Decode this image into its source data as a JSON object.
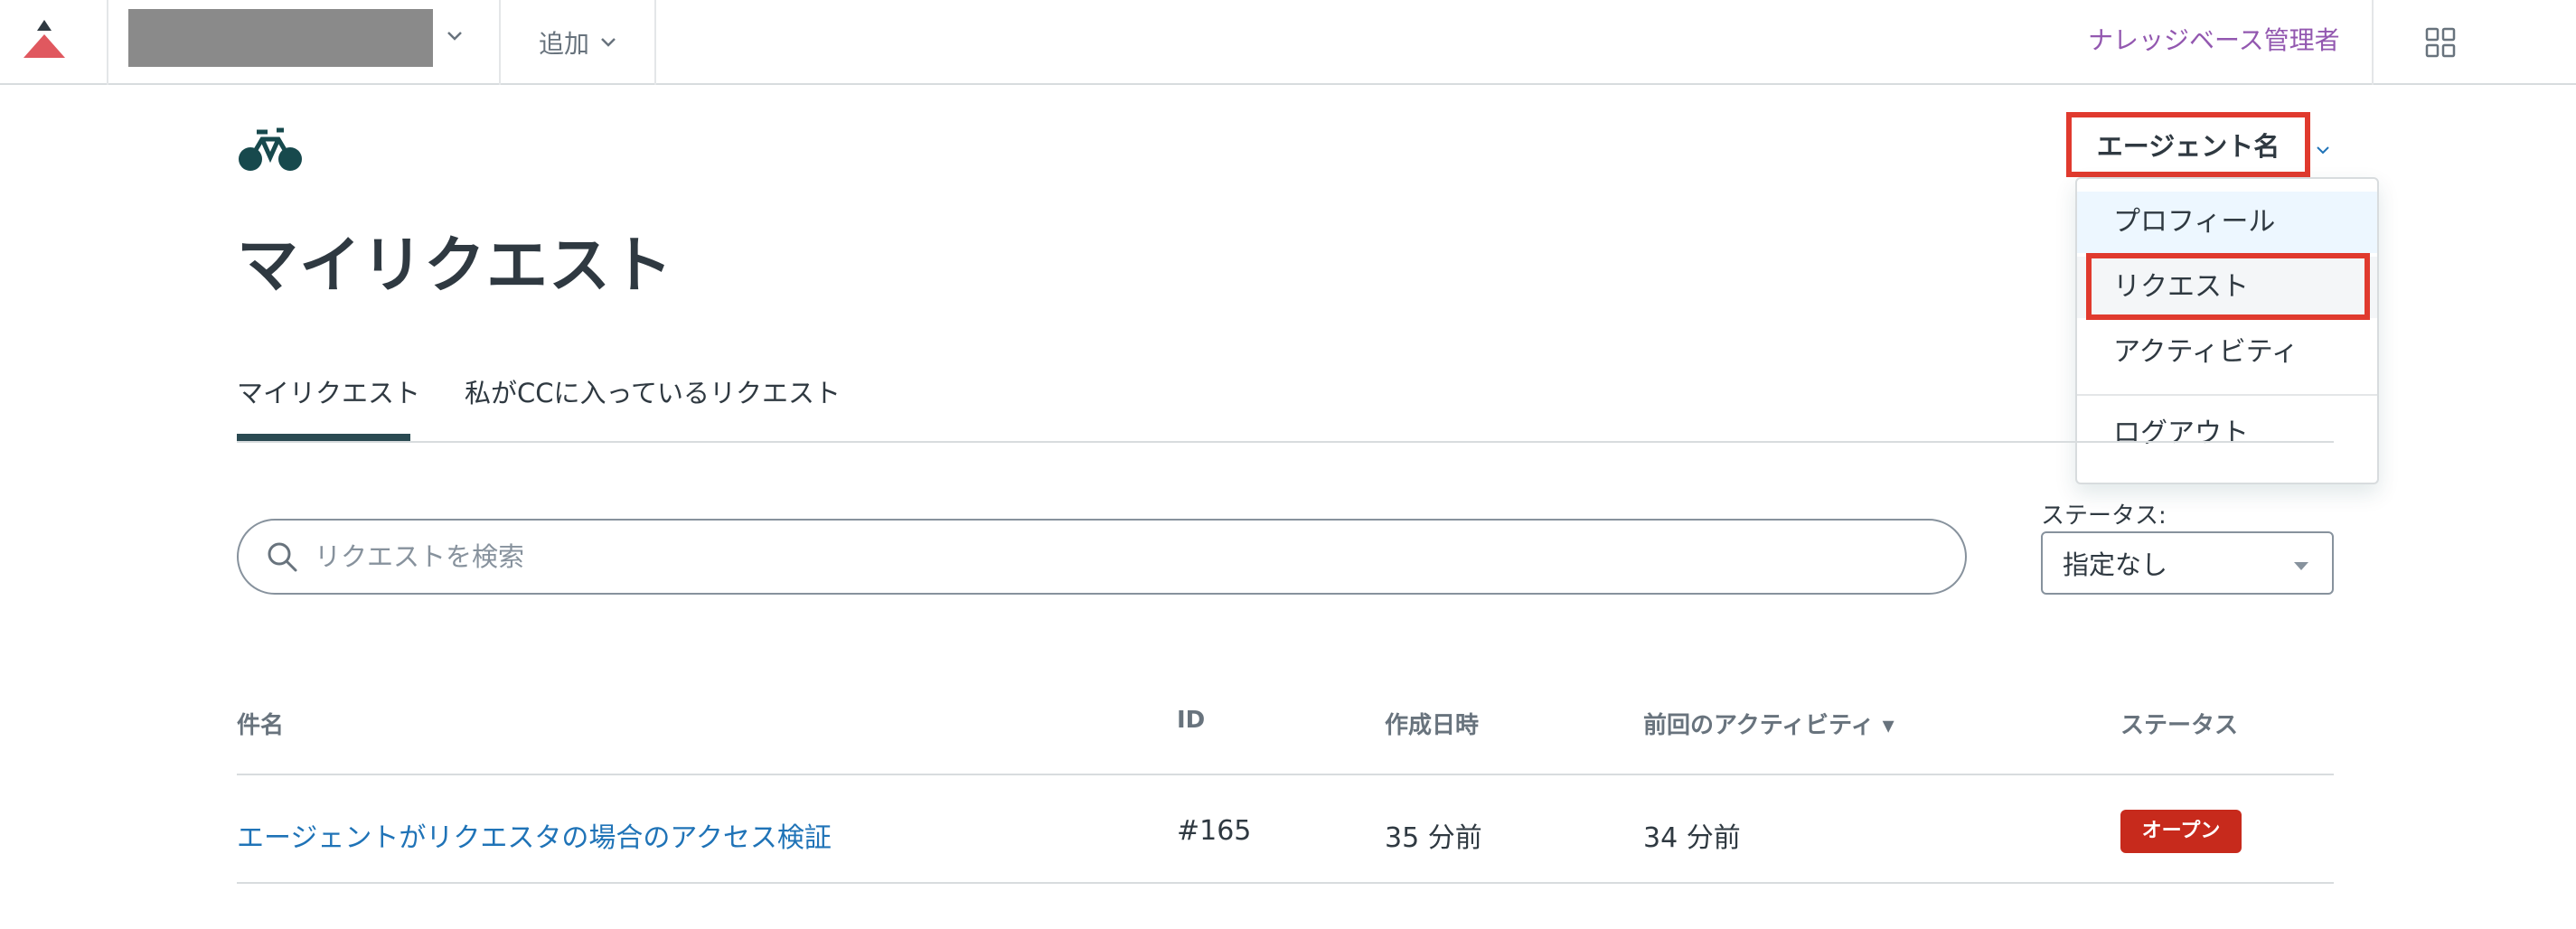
{
  "header": {
    "add_label": "追加",
    "kb_admin_label": "ナレッジベース管理者"
  },
  "user_menu": {
    "name": "エージェント名",
    "items": [
      {
        "label": "プロフィール"
      },
      {
        "label": "リクエスト"
      },
      {
        "label": "アクティビティ"
      },
      {
        "label": "ログアウト"
      }
    ]
  },
  "page": {
    "title": "マイリクエスト"
  },
  "tabs": [
    {
      "label": "マイリクエスト",
      "active": true
    },
    {
      "label": "私がCCに入っているリクエスト",
      "active": false
    }
  ],
  "search": {
    "placeholder": "リクエストを検索",
    "value": ""
  },
  "status_filter": {
    "label": "ステータス:",
    "value": "指定なし"
  },
  "table": {
    "columns": [
      "件名",
      "ID",
      "作成日時",
      "前回のアクティビティ ▾",
      "ステータス"
    ],
    "rows": [
      {
        "subject": "エージェントがリクエスタの場合のアクセス検証",
        "id": "#165",
        "created": "35 分前",
        "last_activity": "34 分前",
        "status": "オープン"
      }
    ]
  },
  "colors": {
    "accent": "#1f73b7",
    "admin_link": "#9358b0",
    "highlight_box": "#e03a2e",
    "status_open": "#c72a1c",
    "brand_triangle": "#e0585f"
  },
  "icons": [
    "brand-logo-icon",
    "chevron-down-icon",
    "apps-grid-icon",
    "bicycle-icon",
    "search-icon",
    "select-caret-icon"
  ]
}
